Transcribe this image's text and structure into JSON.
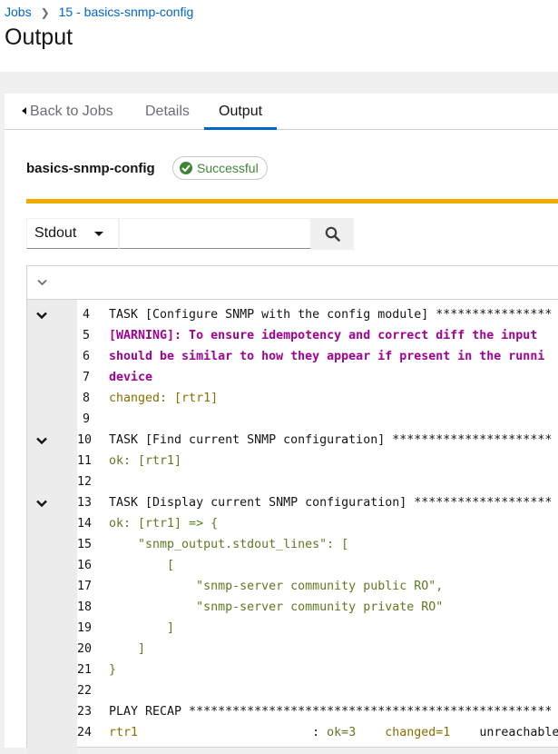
{
  "breadcrumb": {
    "jobs_label": "Jobs",
    "job_label": "15 - basics-snmp-config"
  },
  "page": {
    "title": "Output"
  },
  "tabs": {
    "back_label": "Back to Jobs",
    "details_label": "Details",
    "output_label": "Output",
    "active": "Output"
  },
  "job": {
    "name": "basics-snmp-config",
    "status": "Successful"
  },
  "filter": {
    "selected": "Stdout",
    "search_value": "",
    "search_placeholder": ""
  },
  "colors": {
    "link": "#0066cc",
    "success": "#3e8635",
    "progress": "#f0ab00",
    "warning_text": "#a30096",
    "ok_text": "#5d7b1e",
    "changed_text": "#8b6d00"
  },
  "output": {
    "lines": [
      {
        "num": "4",
        "text": "TASK [Configure SNMP with the config module] ****************",
        "style": "default",
        "collapsible": true
      },
      {
        "num": "5",
        "text": "[WARNING]: To ensure idempotency and correct diff the input",
        "style": "warn",
        "collapsible": false
      },
      {
        "num": "6",
        "text": "should be similar to how they appear if present in the runni",
        "style": "warn",
        "collapsible": false
      },
      {
        "num": "7",
        "text": "device",
        "style": "warn",
        "collapsible": false
      },
      {
        "num": "8",
        "text": "changed: [rtr1]",
        "style": "changed",
        "collapsible": false
      },
      {
        "num": "9",
        "text": "",
        "style": "default",
        "collapsible": false
      },
      {
        "num": "10",
        "text": "TASK [Find current SNMP configuration] **********************",
        "style": "default",
        "collapsible": true
      },
      {
        "num": "11",
        "text": "ok: [rtr1]",
        "style": "ok",
        "collapsible": false
      },
      {
        "num": "12",
        "text": "",
        "style": "default",
        "collapsible": false
      },
      {
        "num": "13",
        "text": "TASK [Display current SNMP configuration] *******************",
        "style": "default",
        "collapsible": true
      },
      {
        "num": "14",
        "text": "ok: [rtr1] => {",
        "style": "ok",
        "collapsible": false
      },
      {
        "num": "15",
        "text": "    \"snmp_output.stdout_lines\": [",
        "style": "ok",
        "collapsible": false
      },
      {
        "num": "16",
        "text": "        [",
        "style": "ok",
        "collapsible": false
      },
      {
        "num": "17",
        "text": "            \"snmp-server community public RO\",",
        "style": "ok",
        "collapsible": false
      },
      {
        "num": "18",
        "text": "            \"snmp-server community private RO\"",
        "style": "ok",
        "collapsible": false
      },
      {
        "num": "19",
        "text": "        ]",
        "style": "ok",
        "collapsible": false
      },
      {
        "num": "20",
        "text": "    ]",
        "style": "ok",
        "collapsible": false
      },
      {
        "num": "21",
        "text": "}",
        "style": "ok",
        "collapsible": false
      },
      {
        "num": "22",
        "text": "",
        "style": "default",
        "collapsible": false
      },
      {
        "num": "23",
        "text": "PLAY RECAP **************************************************",
        "style": "default",
        "collapsible": false
      },
      {
        "num": "24",
        "text": "rtr1                       : ok=3    changed=1    unreachabl",
        "style": "recap",
        "collapsible": false
      }
    ],
    "recap": {
      "host": "rtr1",
      "sep": " : ",
      "ok": "ok=3",
      "changed": "changed=1",
      "rest": "unreachable"
    }
  }
}
